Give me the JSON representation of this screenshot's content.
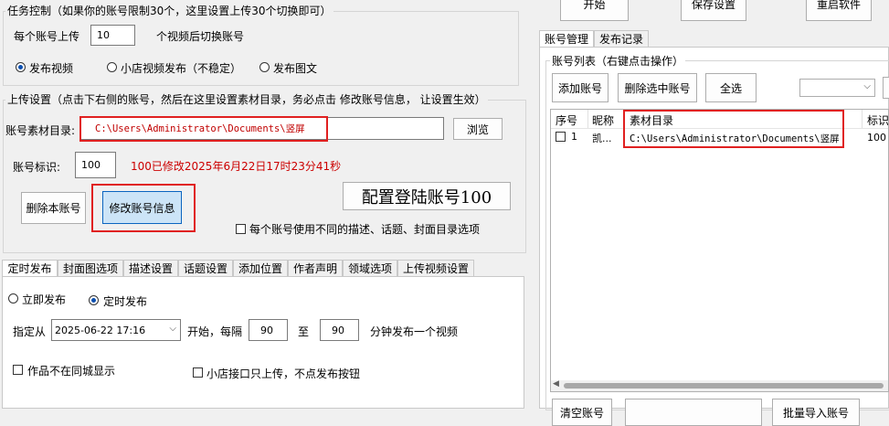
{
  "task_group": {
    "title": "任务控制（如果你的账号限制30个，这里设置上传30个切换即可）",
    "per_account_label": "每个账号上传",
    "per_account_value": "10",
    "switch_label": "个视频后切换账号",
    "radios": [
      "发布视频",
      "小店视频发布（不稳定）",
      "发布图文"
    ]
  },
  "upload_group": {
    "title": "上传设置（点击下右侧的账号，然后在这里设置素材目录，务必点击 修改账号信息， 让设置生效）",
    "material_dir_label": "账号素材目录:",
    "material_dir_value": "C:\\Users\\Administrator\\Documents\\竖屏",
    "browse_label": "浏览",
    "account_id_label": "账号标识:",
    "account_id_value": "100",
    "modified_note": "100已修改2025年6月22日17时23分41秒",
    "delete_account_label": "删除本账号",
    "modify_account_label": "修改账号信息",
    "config_login_label": "配置登陆账号100",
    "diff_options_label": "每个账号使用不同的描述、话题、封面目录选项"
  },
  "bottom_tabs": [
    "定时发布",
    "封面图选项",
    "描述设置",
    "话题设置",
    "添加位置",
    "作者声明",
    "领域选项",
    "上传视频设置"
  ],
  "schedule": {
    "radios": [
      "立即发布",
      "定时发布"
    ],
    "specify_label": "指定从",
    "datetime_value": "2025-06-22  17:16",
    "start_label": "开始，每隔",
    "from_value": "90",
    "to_label": "至",
    "to_value": "90",
    "minutes_label": "分钟发布一个视频",
    "no_same_city_label": "作品不在同城显示",
    "shop_only_label": "小店接口只上传，不点发布按钮"
  },
  "top_buttons": [
    "开始",
    "保存设置",
    "重启软件"
  ],
  "right_tabs": [
    "账号管理",
    "发布记录"
  ],
  "account_group": {
    "title": "账号列表（右键点击操作）",
    "add_label": "添加账号",
    "delete_selected_label": "删除选中账号",
    "select_all_label": "全选",
    "columns": [
      "序号",
      "昵称",
      "素材目录",
      "标识"
    ],
    "rows": [
      {
        "index": "1",
        "nickname": "凯...",
        "dir": "C:\\Users\\Administrator\\Documents\\竖屏",
        "id": "100"
      }
    ],
    "bottom_buttons": [
      "清空账号",
      "",
      "批量导入账号"
    ]
  },
  "colors": {
    "accent_red": "#e02020",
    "selected_button": "#cce4f7",
    "note_red": "#cc0000"
  }
}
